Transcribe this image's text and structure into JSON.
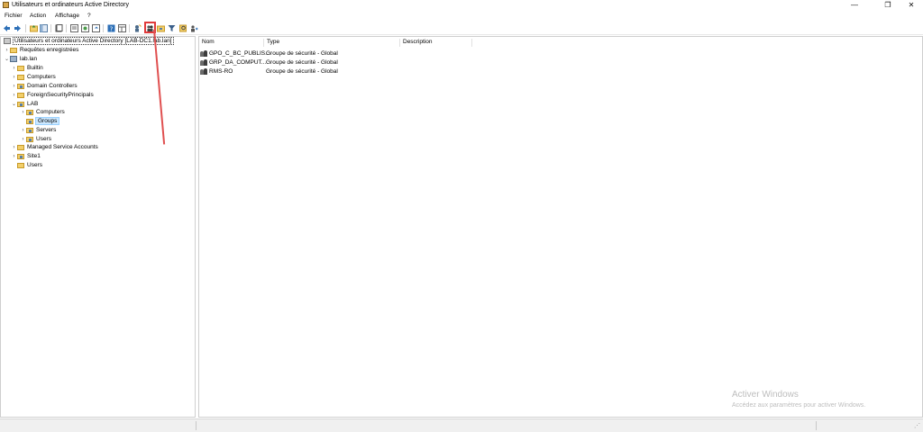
{
  "window": {
    "title": "Utilisateurs et ordinateurs Active Directory",
    "minimize": "—",
    "restore": "❐",
    "close": "✕"
  },
  "menu": [
    "Fichier",
    "Action",
    "Affichage",
    "?"
  ],
  "toolbar": {
    "icons": [
      "back-arrow-icon",
      "forward-arrow-icon",
      "up-folder-icon",
      "console-tree-icon",
      "copy-icon",
      "properties-icon",
      "export-icon",
      "refresh-icon",
      "help-icon",
      "details-view-icon",
      "new-user-icon",
      "new-group-icon",
      "new-ou-icon",
      "filter-icon",
      "find-icon",
      "add-to-group-icon"
    ],
    "highlighted": "new-group-icon"
  },
  "tree": {
    "root": "Utilisateurs et ordinateurs Active Directory [LAB-DC1.lab.lan]",
    "items": [
      {
        "label": "Requêtes enregistrées",
        "level": 1,
        "chevron": "›",
        "type": "folder"
      },
      {
        "label": "lab.lan",
        "level": 1,
        "chevron": "⌄",
        "type": "domain"
      },
      {
        "label": "Builtin",
        "level": 2,
        "chevron": "›",
        "type": "folder"
      },
      {
        "label": "Computers",
        "level": 2,
        "chevron": "›",
        "type": "folder"
      },
      {
        "label": "Domain Controllers",
        "level": 2,
        "chevron": "›",
        "type": "ou"
      },
      {
        "label": "ForeignSecurityPrincipals",
        "level": 2,
        "chevron": "›",
        "type": "folder"
      },
      {
        "label": "LAB",
        "level": 2,
        "chevron": "⌄",
        "type": "ou"
      },
      {
        "label": "Computers",
        "level": 3,
        "chevron": "›",
        "type": "ou"
      },
      {
        "label": "Groups",
        "level": 3,
        "chevron": "",
        "type": "ou",
        "selected": true
      },
      {
        "label": "Servers",
        "level": 3,
        "chevron": "›",
        "type": "ou"
      },
      {
        "label": "Users",
        "level": 3,
        "chevron": "›",
        "type": "ou"
      },
      {
        "label": "Managed Service Accounts",
        "level": 2,
        "chevron": "›",
        "type": "folder"
      },
      {
        "label": "Site1",
        "level": 2,
        "chevron": "›",
        "type": "ou"
      },
      {
        "label": "Users",
        "level": 2,
        "chevron": "",
        "type": "folder"
      }
    ]
  },
  "list": {
    "columns": [
      "Nom",
      "Type",
      "Description"
    ],
    "rows": [
      {
        "name": "GPO_C_BC_PUBLIS...",
        "type": "Groupe de sécurité - Global",
        "description": ""
      },
      {
        "name": "GRP_DA_COMPUT...",
        "type": "Groupe de sécurité - Global",
        "description": ""
      },
      {
        "name": "RMS-RO",
        "type": "Groupe de sécurité - Global",
        "description": ""
      }
    ]
  },
  "watermark": {
    "title": "Activer Windows",
    "subtitle": "Accédez aux paramètres pour activer Windows."
  },
  "colors": {
    "selection": "#cce8ff",
    "annotation": "#e03a3a",
    "folder": "#f2cf6a"
  }
}
